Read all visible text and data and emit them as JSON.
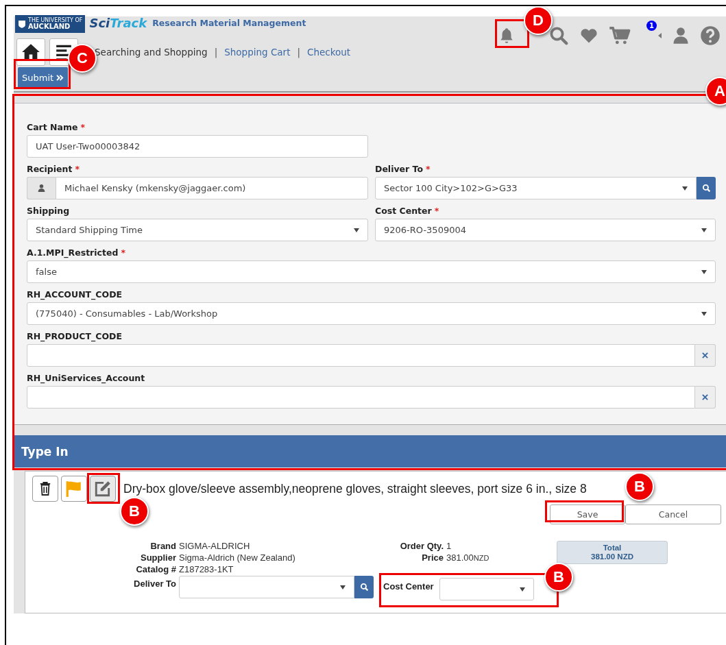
{
  "header": {
    "logo_top": "THE UNIVERSITY OF",
    "logo_bottom": "AUCKLAND",
    "app_name_first": "Sci",
    "app_name_second": "Track",
    "subtitle": "Research Material Management",
    "cart_count": "1"
  },
  "breadcrumb": [
    {
      "label": "Searching and Shopping",
      "link": false
    },
    {
      "separator": "|",
      "label": "Shopping Cart",
      "link": true
    },
    {
      "separator": "|",
      "label": "Checkout",
      "link": true
    }
  ],
  "submit_button": "Submit",
  "form_rows": [
    [
      {
        "label": "Cart Name",
        "required_mark": "*",
        "kind": "text",
        "value": "UAT User-Two00003842"
      }
    ],
    [
      {
        "label": "Recipient",
        "required_mark": "*",
        "kind": "person",
        "value": "Michael Kensky (mkensky@jaggaer.com)"
      },
      {
        "label": "Deliver To",
        "required_mark": "*",
        "kind": "select_search",
        "value": "Sector 100 City>102>G>G33"
      }
    ],
    [
      {
        "label": "Shipping",
        "kind": "select",
        "value": "Standard Shipping Time"
      },
      {
        "label": "Cost Center",
        "required_mark": "*",
        "kind": "select",
        "value": "9206-RO-3509004"
      }
    ],
    [
      {
        "label": "A.1.MPI_Restricted",
        "required_mark": "*",
        "kind": "select",
        "value": "false"
      }
    ],
    [
      {
        "label": "RH_ACCOUNT_CODE",
        "kind": "select",
        "value": "(775040) - Consumables - Lab/Workshop"
      }
    ],
    [
      {
        "label": "RH_PRODUCT_CODE",
        "kind": "clearable"
      }
    ],
    [
      {
        "label": "RH_UniServices_Account",
        "kind": "clearable"
      }
    ]
  ],
  "section_title": "Type In",
  "item": {
    "title": "Dry-box glove/sleeve assembly,neoprene gloves, straight sleeves, port size 6 in., size 8",
    "save_button": "Save",
    "cancel_button": "Cancel",
    "details_left": [
      {
        "label": "Brand",
        "value": "SIGMA-ALDRICH"
      },
      {
        "label": "Supplier",
        "value": "Sigma-Aldrich (New Zealand)"
      },
      {
        "label": "Catalog #",
        "value": "Z187283-1KT"
      }
    ],
    "details_right": [
      {
        "label": "Order Qty.",
        "value": "1"
      },
      {
        "label": "Price",
        "value": "381.00",
        "unit": "NZD"
      }
    ],
    "total_label": "Total",
    "total_value": "381.00 NZD",
    "deliver_to_label": "Deliver To",
    "cost_center_label": "Cost Center"
  },
  "annotations": [
    {
      "letter": "A"
    },
    {
      "letter": "B"
    },
    {
      "letter": "B"
    },
    {
      "letter": "B"
    },
    {
      "letter": "C"
    },
    {
      "letter": "D"
    }
  ]
}
